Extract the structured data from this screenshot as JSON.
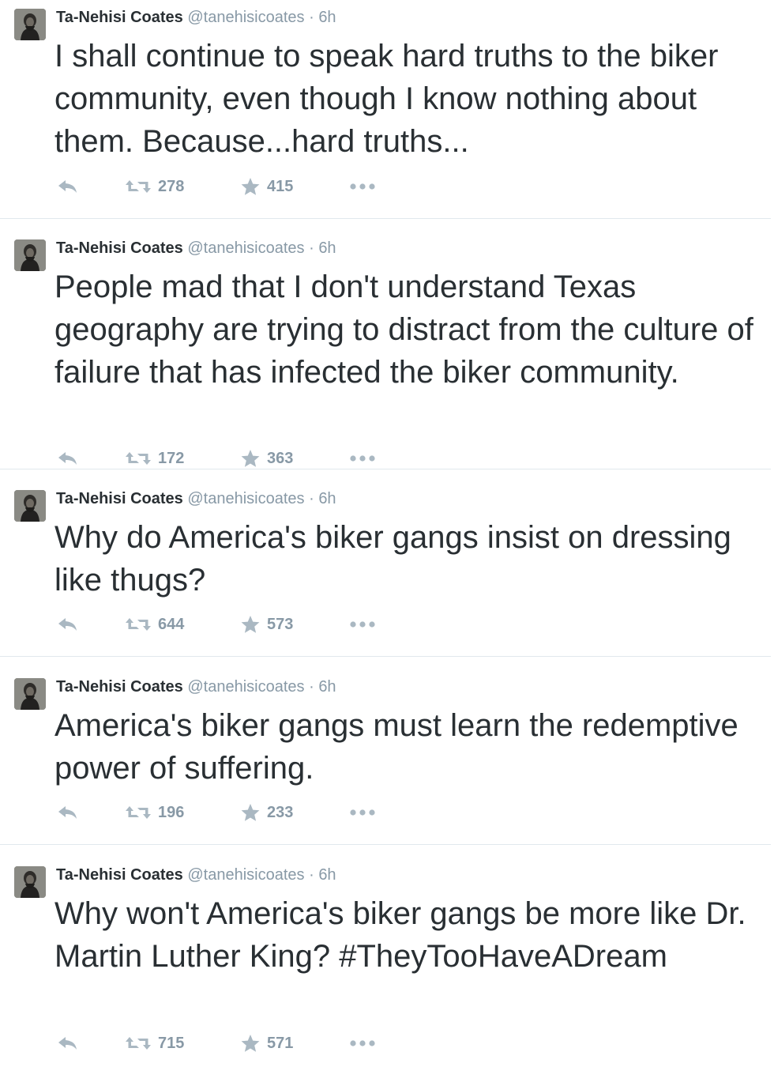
{
  "tweets": [
    {
      "author": "Ta-Nehisi Coates",
      "handle": "@tanehisicoates",
      "sep": "·",
      "time": "6h",
      "text": "I shall continue to speak hard truths to the biker community, even though I know nothing about them. Because...hard truths...",
      "retweets": "278",
      "favorites": "415"
    },
    {
      "author": "Ta-Nehisi Coates",
      "handle": "@tanehisicoates",
      "sep": "·",
      "time": "6h",
      "text": "People mad that I don't understand Texas geography are trying to distract from the culture of failure that has infected the biker community.",
      "retweets": "172",
      "favorites": "363"
    },
    {
      "author": "Ta-Nehisi Coates",
      "handle": "@tanehisicoates",
      "sep": "·",
      "time": "6h",
      "text": "Why do America's biker gangs insist on dressing like thugs?",
      "retweets": "644",
      "favorites": "573"
    },
    {
      "author": "Ta-Nehisi Coates",
      "handle": "@tanehisicoates",
      "sep": "·",
      "time": "6h",
      "text": "America's biker gangs must learn the redemptive power of suffering.",
      "retweets": "196",
      "favorites": "233"
    },
    {
      "author": "Ta-Nehisi Coates",
      "handle": "@tanehisicoates",
      "sep": "·",
      "time": "6h",
      "text": "Why won't America's biker gangs be more like Dr. Martin Luther King? #TheyTooHaveADream",
      "retweets": "715",
      "favorites": "571"
    }
  ],
  "icons": {
    "avatar": "profile-photo-icon",
    "reply": "reply-arrow-icon",
    "retweet": "retweet-icon",
    "favorite": "star-icon",
    "more": "more-dots-icon"
  },
  "colors": {
    "text": "#292f33",
    "muted": "#8899a6",
    "icon": "#aab8c2",
    "divider": "#e1e8ed"
  }
}
